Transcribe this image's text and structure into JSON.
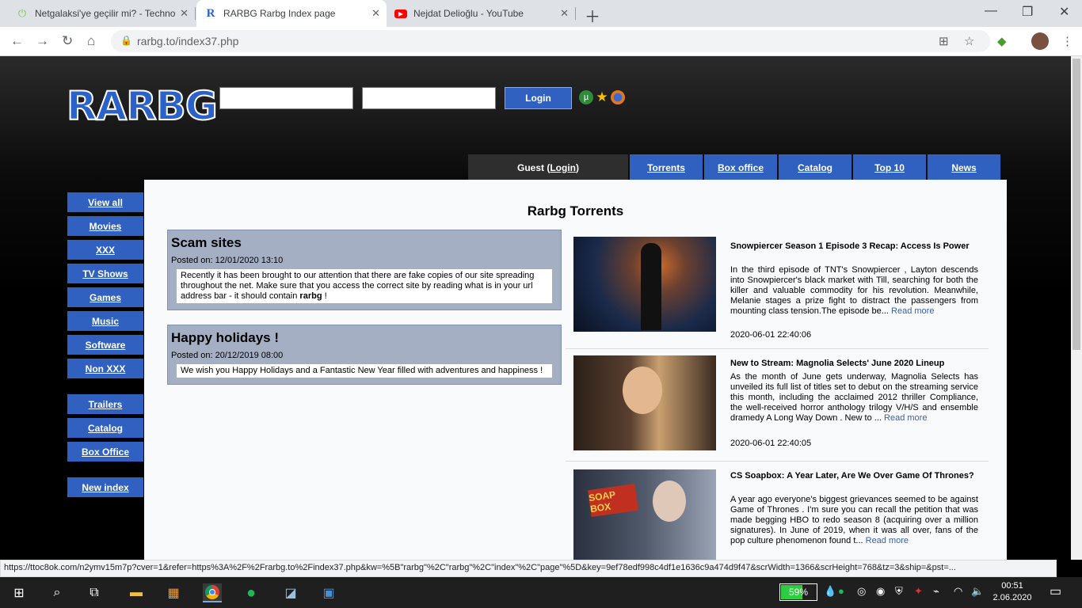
{
  "browser": {
    "tabs": [
      {
        "title": "Netgalaksi'ye geçilir mi? - Techno"
      },
      {
        "title": "RARBG Rarbg Index page"
      },
      {
        "title": "Nejdat Delioğlu - YouTube"
      }
    ],
    "url": "rarbg.to/index37.php",
    "status_url": "https://ttoc8ok.com/n2ymv15m7p?cver=1&refer=https%3A%2F%2Frarbg.to%2Findex37.php&kw=%5B\"rarbg\"%2C\"rarbg\"%2C\"index\"%2C\"page\"%5D&key=9ef78edf998c4df1e1636c9a474d9f47&scrWidth=1366&scrHeight=768&tz=3&ship=&pst=..."
  },
  "site": {
    "logo": "RARBG",
    "login_button": "Login",
    "guest_prefix": "Guest (",
    "guest_link": "Login",
    "guest_suffix": ")",
    "nav_tabs": [
      "Torrents",
      "Box office",
      "Catalog",
      "Top 10",
      "News"
    ],
    "sidebar": [
      "View all",
      "Movies",
      "XXX",
      "TV Shows",
      "Games",
      "Music",
      "Software",
      "Non XXX",
      "Trailers",
      "Catalog",
      "Box Office",
      "New index"
    ],
    "content_title": "Rarbg Torrents",
    "news": [
      {
        "title": "Scam sites",
        "posted": "Posted on: 12/01/2020 13:10",
        "body_pre": "Recently it has been brought to our attention that there are fake copies of our site spreading throughout the net. Make sure that you access the correct site by reading what is in your url address bar - it should contain ",
        "body_bold": "rarbg",
        "body_post": " !"
      },
      {
        "title": "Happy holidays !",
        "posted": "Posted on: 20/12/2019 08:00",
        "body_pre": "We wish you Happy Holidays and a Fantastic New Year filled with adventures and happiness !",
        "body_bold": "",
        "body_post": ""
      }
    ],
    "articles": [
      {
        "title": "Snowpiercer Season 1 Episode 3 Recap: Access Is Power",
        "excerpt": "In the third episode of TNT's Snowpiercer , Layton descends into Snowpiercer's black market with Till, searching for both the killer and valuable commodity for his revolution. Meanwhile, Melanie stages a prize fight to distract the passengers from mounting class tension.The episode be... ",
        "read_more": "Read more",
        "date": "2020-06-01 22:40:06",
        "img_colors": [
          "#1a2a4a",
          "#c96a2a"
        ]
      },
      {
        "title": "New to Stream: Magnolia Selects' June 2020 Lineup",
        "excerpt": "As the month of June gets underway, Magnolia Selects has unveiled its full list of titles set to debut on the streaming service this month, including the acclaimed 2012 thriller Compliance, the well-received horror anthology trilogy V/H/S and ensemble dramedy A Long Way Down . New to ... ",
        "read_more": "Read more",
        "date": "2020-06-01 22:40:05",
        "img_colors": [
          "#3a2a20",
          "#c9a070"
        ]
      },
      {
        "title": "CS Soapbox: A Year Later, Are We Over Game Of Thrones?",
        "excerpt": "A year ago everyone's biggest grievances seemed to be against Game of Thrones . I'm sure you can recall the petition that was made begging HBO to redo season 8 (acquiring over a million signatures). In June of 2019, when it was all over, fans of the pop culture phenomenon found t... ",
        "read_more": "Read more",
        "date": "",
        "img_colors": [
          "#2a3040",
          "#9aa4b4"
        ],
        "img_label": "SOAP BOX"
      }
    ]
  },
  "taskbar": {
    "battery": "59%",
    "battery_level": 0.59,
    "time": "00:51",
    "date": "2.06.2020"
  }
}
